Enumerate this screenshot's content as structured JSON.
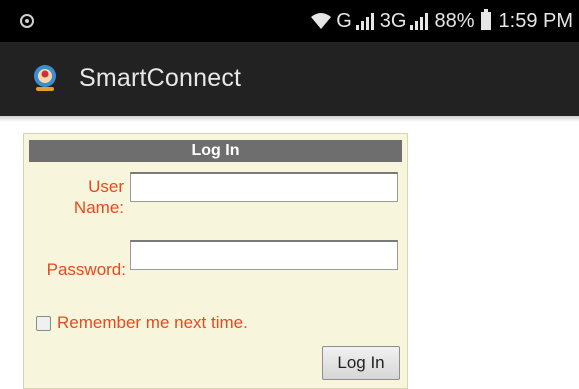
{
  "status_bar": {
    "network_label": "G",
    "network_label_2": "3G",
    "battery_percent": "88%",
    "time": "1:59 PM",
    "icons": [
      "notification-icon",
      "wifi-icon",
      "signal-icon",
      "signal-icon",
      "battery-icon"
    ]
  },
  "action_bar": {
    "app_title": "SmartConnect",
    "app_icon": "smartconnect-logo-icon"
  },
  "login": {
    "header": "Log In",
    "username_label_line1": "User",
    "username_label_line2": "Name:",
    "username_value": "",
    "password_label": "Password:",
    "password_value": "",
    "remember_label": "Remember me next time.",
    "remember_checked": false,
    "submit_label": "Log In"
  },
  "colors": {
    "status_bar_bg": "#000000",
    "action_bar_bg": "#222222",
    "panel_bg": "#f7f5dc",
    "header_bg": "#6e6e6e",
    "label_color": "#e8491d"
  }
}
